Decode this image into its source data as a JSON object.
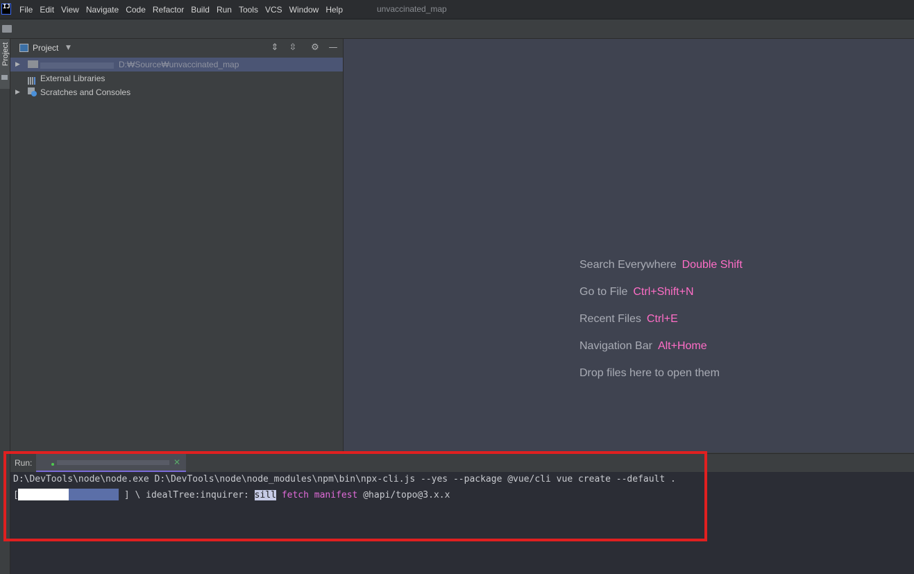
{
  "menubar": {
    "app_icon_text": "IJ",
    "items": [
      "File",
      "Edit",
      "View",
      "Navigate",
      "Code",
      "Refactor",
      "Build",
      "Run",
      "Tools",
      "VCS",
      "Window",
      "Help"
    ],
    "window_title": "unvaccinated_map"
  },
  "navbar": {
    "breadcrumb": ""
  },
  "tool_strip": {
    "project_label": "Project"
  },
  "project_panel": {
    "title": "Project",
    "tree": {
      "root_path": "D:₩Source₩unvaccinated_map",
      "external_libraries": "External Libraries",
      "scratches": "Scratches and Consoles"
    }
  },
  "editor_hints": [
    {
      "label": "Search Everywhere",
      "key": "Double Shift"
    },
    {
      "label": "Go to File",
      "key": "Ctrl+Shift+N"
    },
    {
      "label": "Recent Files",
      "key": "Ctrl+E"
    },
    {
      "label": "Navigation Bar",
      "key": "Alt+Home"
    },
    {
      "label": "Drop files here to open them",
      "key": ""
    }
  ],
  "run": {
    "label": "Run:",
    "console_line1": "D:\\DevTools\\node\\node.exe D:\\DevTools\\node\\node_modules\\npm\\bin\\npx-cli.js --yes --package @vue/cli vue create --default .",
    "line2_prefix": "[",
    "line2_mid": "] \\ idealTree:inquirer: ",
    "line2_sill": "sill",
    "line2_fetch": "fetch manifest",
    "line2_pkg": " @hapi/topo@3.x.x"
  },
  "colors": {
    "accent_key": "#ff6ec7",
    "highlight_box": "#e02020",
    "selected_row": "#4b5574"
  }
}
